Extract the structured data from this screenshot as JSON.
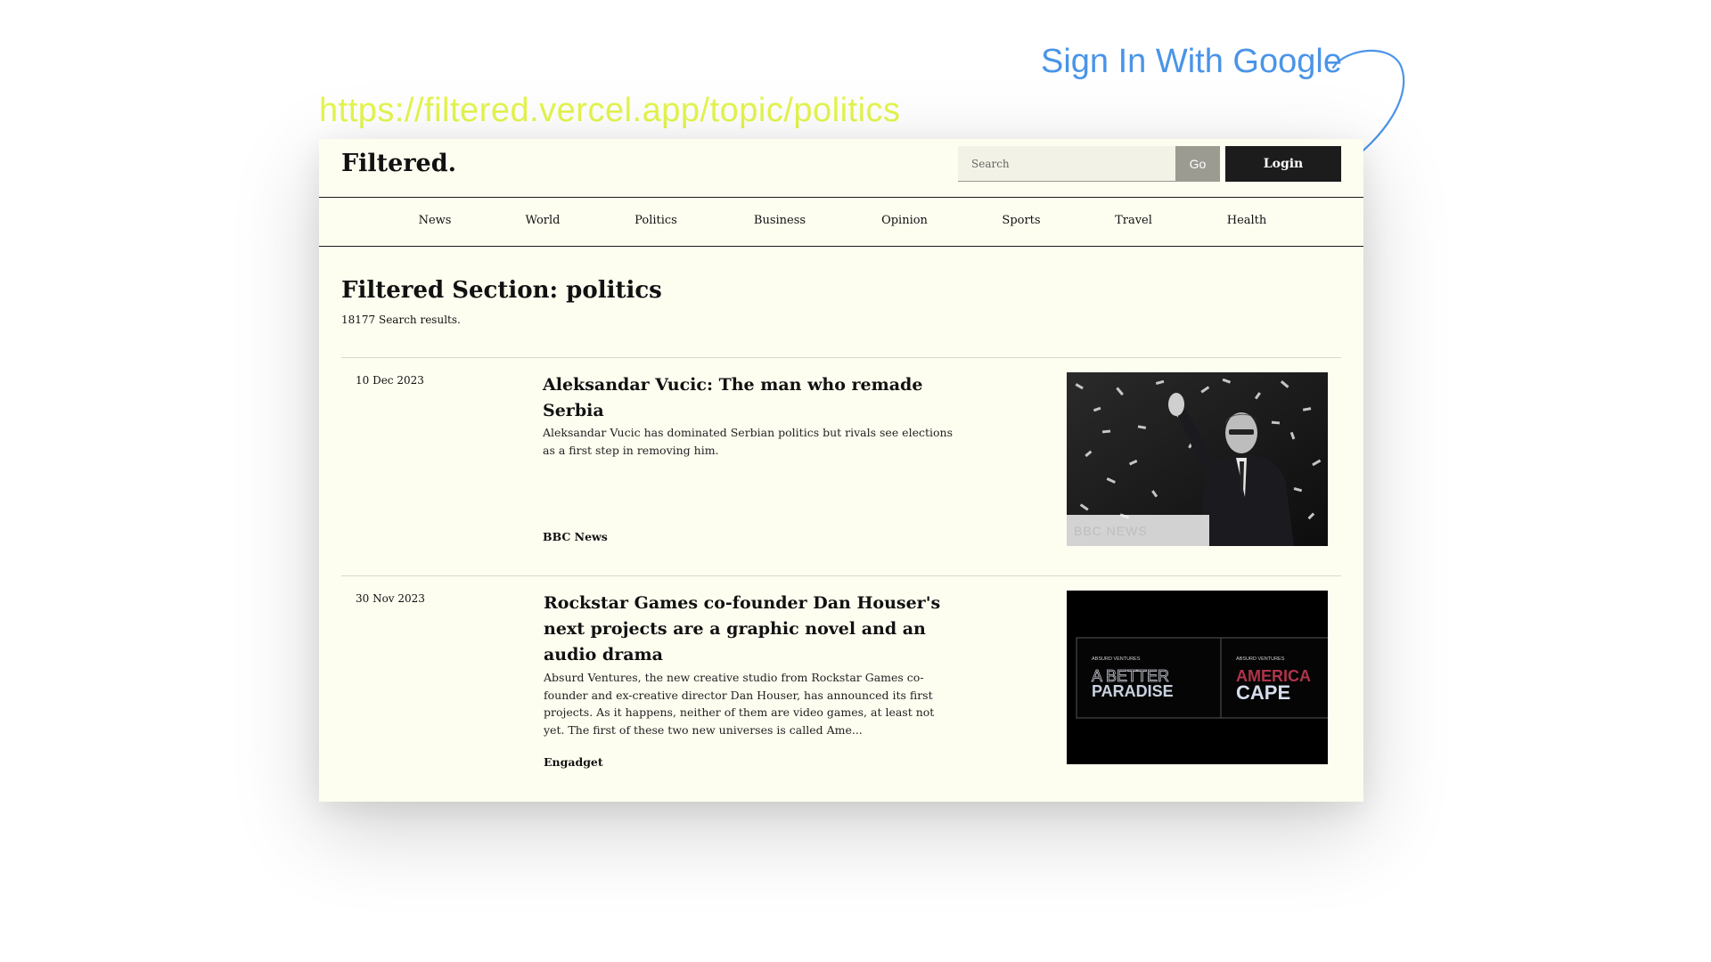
{
  "url_caption": "https://filtered.vercel.app/topic/politics",
  "annotation": {
    "label": "Sign In With Google",
    "color": "#4a94e8"
  },
  "header": {
    "brand": "Filtered.",
    "search_placeholder": "Search",
    "go_label": "Go",
    "login_label": "Login"
  },
  "nav": {
    "items": [
      {
        "label": "News"
      },
      {
        "label": "World"
      },
      {
        "label": "Politics"
      },
      {
        "label": "Business"
      },
      {
        "label": "Opinion"
      },
      {
        "label": "Sports"
      },
      {
        "label": "Travel"
      },
      {
        "label": "Health"
      }
    ]
  },
  "section": {
    "title": "Filtered Section: politics",
    "result_count": "18177 Search results."
  },
  "articles": [
    {
      "date": "10 Dec 2023",
      "title": "Aleksandar Vucic: The man who remade Serbia",
      "summary": "Aleksandar Vucic has dominated Serbian politics but rivals see elections as a first step in removing him.",
      "source": "BBC News",
      "thumbnail": {
        "icon": "photo-man-waving-confetti",
        "watermark": "BBC NEWS"
      }
    },
    {
      "date": "30 Nov 2023",
      "title": "Rockstar Games co-founder Dan Houser's next projects are a graphic novel and an audio drama",
      "summary": "Absurd Ventures, the new creative studio from Rockstar Games co-founder and ex-creative director Dan Houser, has announced its first projects. As it happens, neither of them are video games, at least not yet. The first of these two new universes is called Ame...",
      "source": "Engadget",
      "thumbnail": {
        "icon": "promo-art-two-panels",
        "panel1_kicker": "ABSURD VENTURES",
        "panel1_line1": "A BETTER",
        "panel1_line2": "PARADISE",
        "panel2_kicker": "ABSURD VENTURES",
        "panel2_line1": "AMERICA",
        "panel2_line2": "CAPE"
      }
    }
  ],
  "colors": {
    "page_background": "#fdfdf0",
    "url_caption": "#e4f54e",
    "login_button": "#1c1c1c",
    "go_button": "#9b9b92"
  }
}
